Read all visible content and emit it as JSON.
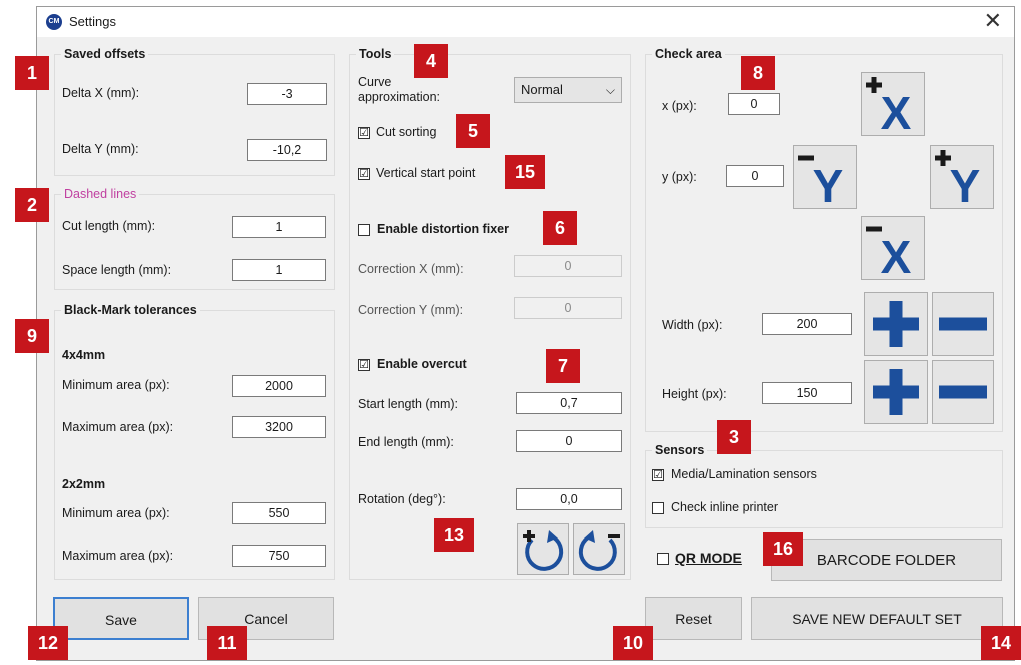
{
  "window": {
    "logo": "CM",
    "title": "Settings",
    "close": "✕"
  },
  "saved_offsets": {
    "title": "Saved offsets",
    "delta_x_label": "Delta X (mm):",
    "delta_x": "-3",
    "delta_y_label": "Delta Y (mm):",
    "delta_y": "-10,2"
  },
  "dashed_lines": {
    "title": "Dashed lines",
    "title_color": "#c040a0",
    "cut_label": "Cut length (mm):",
    "cut": "1",
    "space_label": "Space length (mm):",
    "space": "1"
  },
  "blackmark": {
    "title": "Black-Mark tolerances",
    "g4_title": "4x4mm",
    "g4_min_label": "Minimum area (px):",
    "g4_min": "2000",
    "g4_max_label": "Maximum area (px):",
    "g4_max": "3200",
    "g2_title": "2x2mm",
    "g2_min_label": "Minimum area (px):",
    "g2_min": "550",
    "g2_max_label": "Maximum area (px):",
    "g2_max": "750"
  },
  "tools": {
    "title": "Tools",
    "curve_label_1": "Curve",
    "curve_label_2": "approximation:",
    "curve_value": "Normal",
    "cut_sorting": "Cut sorting",
    "cut_sorting_checked": "☑",
    "vertical_start": "Vertical start point",
    "vertical_start_checked": "☑",
    "distortion": "Enable distortion fixer",
    "distortion_checked": "",
    "corr_x_label": "Correction X (mm):",
    "corr_x": "0",
    "corr_y_label": "Correction Y (mm):",
    "corr_y": "0",
    "overcut": "Enable overcut",
    "overcut_checked": "☑",
    "start_label": "Start length (mm):",
    "start": "0,7",
    "end_label": "End length (mm):",
    "end": "0",
    "rotation_label": "Rotation (deg°):",
    "rotation": "0,0"
  },
  "check_area": {
    "title": "Check area",
    "x_label": "x (px):",
    "x": "0",
    "y_label": "y (px):",
    "y": "0",
    "width_label": "Width (px):",
    "width": "200",
    "height_label": "Height (px):",
    "height": "150",
    "plus_x": "X",
    "minus_x": "X",
    "plus_y": "Y",
    "minus_y": "Y"
  },
  "sensors": {
    "title": "Sensors",
    "media": "Media/Lamination sensors",
    "media_checked": "☑",
    "inline": "Check inline printer",
    "inline_checked": ""
  },
  "qr": {
    "label": "QR MODE",
    "checked": ""
  },
  "buttons": {
    "barcode": "BARCODE FOLDER",
    "save": "Save",
    "cancel": "Cancel",
    "reset": "Reset",
    "save_default": "SAVE NEW DEFAULT SET"
  },
  "badges": [
    "1",
    "2",
    "3",
    "4",
    "5",
    "6",
    "7",
    "8",
    "9",
    "10",
    "11",
    "12",
    "13",
    "14",
    "15",
    "16"
  ],
  "colors": {
    "badge": "#c6161c",
    "icon_blue": "#1c4f9c",
    "accent_border": "#3c7fd0"
  }
}
